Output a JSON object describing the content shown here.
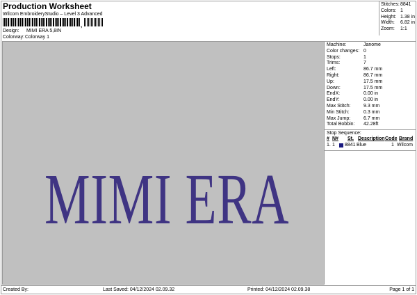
{
  "header": {
    "title": "Production Worksheet",
    "subtitle": "Wilcom EmbroideryStudio – Level 3 Advanced",
    "design_label": "Design:",
    "design_value": "MIMI ERA 5,8IN",
    "colorway_label": "Colorway:",
    "colorway_value": "Colorway 1"
  },
  "stats": [
    {
      "k": "Stitches:",
      "v": "8841"
    },
    {
      "k": "Colors:",
      "v": "1"
    },
    {
      "k": "Height:",
      "v": "1.38 in"
    },
    {
      "k": "Width:",
      "v": "6.82 in"
    },
    {
      "k": "Zoom:",
      "v": "1:1"
    }
  ],
  "canvas": {
    "design_text": "MIMI ERA",
    "thread_color": "#3f3483"
  },
  "specs": [
    {
      "k": "Machine:",
      "v": "Janome"
    },
    {
      "k": "Color changes:",
      "v": "0"
    },
    {
      "k": "Stops:",
      "v": "1"
    },
    {
      "k": "Trims:",
      "v": "7"
    },
    {
      "k": "Left:",
      "v": "86.7 mm"
    },
    {
      "k": "Right:",
      "v": "86.7 mm"
    },
    {
      "k": "Up:",
      "v": "17.5 mm"
    },
    {
      "k": "Down:",
      "v": "17.5 mm"
    },
    {
      "k": "EndX:",
      "v": "0.00 in"
    },
    {
      "k": "EndY:",
      "v": "0.00 in"
    },
    {
      "k": "Max Stitch:",
      "v": "9.3 mm"
    },
    {
      "k": "Min Stitch:",
      "v": "0.3 mm"
    },
    {
      "k": "Max Jump:",
      "v": "6.7 mm"
    },
    {
      "k": "Total Bobbin:",
      "v": "42.28ft"
    }
  ],
  "stop_sequence": {
    "title": "Stop Sequence:",
    "headers": [
      "#",
      "N#",
      "St.",
      "Description",
      "Code",
      "Brand"
    ],
    "rows": [
      {
        "num": "1.",
        "n": "1",
        "swatch": "#1a1a80",
        "st": "8841",
        "description": "Blue",
        "code": "1",
        "brand": "Wilcom"
      }
    ]
  },
  "footer": {
    "created_by": "Created By:",
    "last_saved": "Last Saved: 04/12/2024 02.09.32",
    "printed": "Printed: 04/12/2024 02.09.38",
    "page": "Page 1 of 1"
  }
}
